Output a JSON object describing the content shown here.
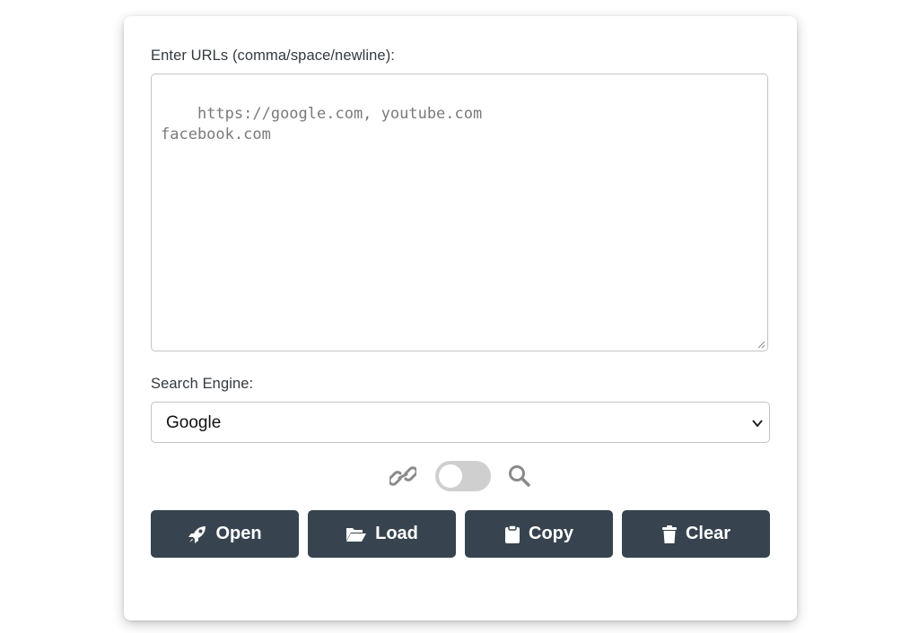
{
  "form": {
    "urls_label": "Enter URLs (comma/space/newline):",
    "urls_placeholder": "https://google.com, youtube.com\nfacebook.com",
    "urls_value": "",
    "engine_label": "Search Engine:",
    "engine_selected": "Google"
  },
  "toggle": {
    "left_icon": "link-icon",
    "right_icon": "search-icon",
    "state": "off"
  },
  "buttons": {
    "open": {
      "label": "Open",
      "icon": "rocket-icon"
    },
    "load": {
      "label": "Load",
      "icon": "folder-open-icon"
    },
    "copy": {
      "label": "Copy",
      "icon": "clipboard-icon"
    },
    "clear": {
      "label": "Clear",
      "icon": "trash-icon"
    }
  },
  "colors": {
    "button_bg": "#37444f",
    "button_text": "#ffffff",
    "toggle_track": "#cfcfcf",
    "icon_gray": "#8a8a8a"
  }
}
